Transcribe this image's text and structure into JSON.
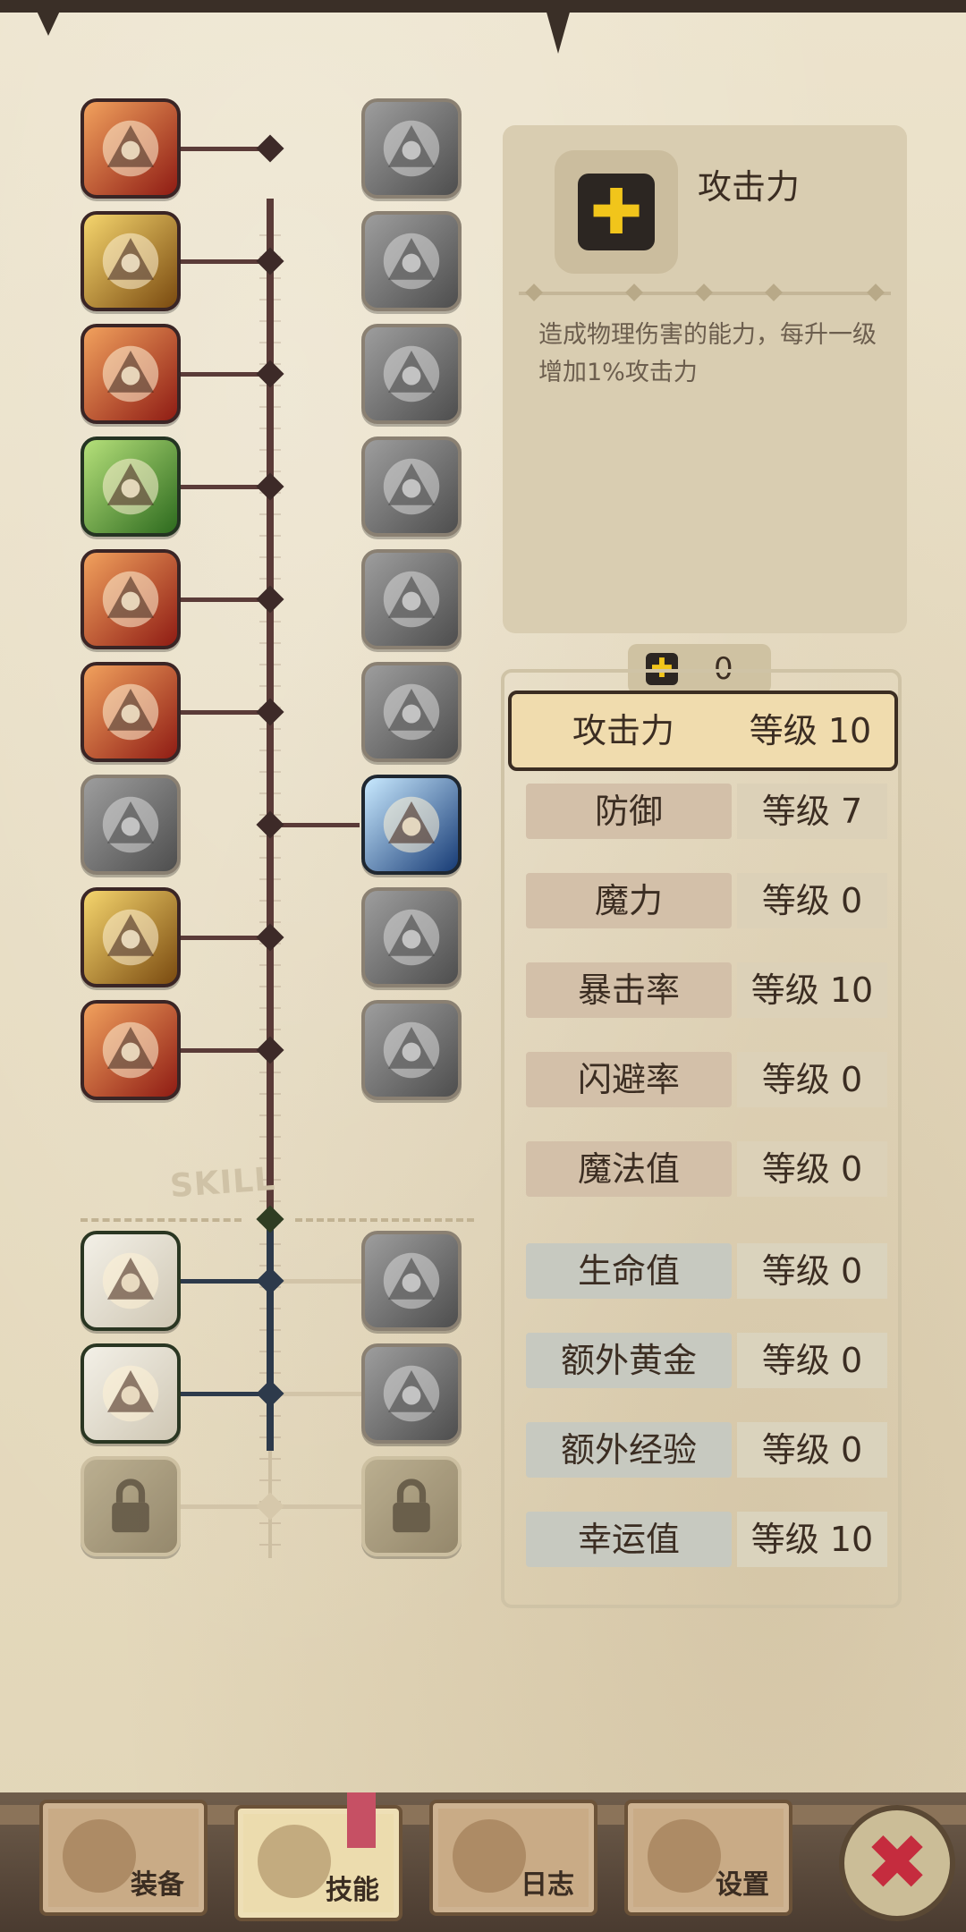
{
  "info": {
    "title": "攻击力",
    "plus_symbol": "✚",
    "description": "造成物理伤害的能力，每升一级增加1%攻击力"
  },
  "points": {
    "value": "0"
  },
  "skill_label": "SKILL",
  "stats": [
    {
      "name": "攻击力",
      "level": "等级 10",
      "group": "red",
      "selected": true
    },
    {
      "name": "防御",
      "level": "等级 7",
      "group": "red"
    },
    {
      "name": "魔力",
      "level": "等级 0",
      "group": "red"
    },
    {
      "name": "暴击率",
      "level": "等级 10",
      "group": "red"
    },
    {
      "name": "闪避率",
      "level": "等级 0",
      "group": "red"
    },
    {
      "name": "魔法值",
      "level": "等级 0",
      "group": "red"
    },
    {
      "name": "生命值",
      "level": "等级 0",
      "group": "blue"
    },
    {
      "name": "额外黄金",
      "level": "等级 0",
      "group": "blue"
    },
    {
      "name": "额外经验",
      "level": "等级 0",
      "group": "blue"
    },
    {
      "name": "幸运值",
      "level": "等级 10",
      "group": "blue"
    }
  ],
  "tabs": [
    {
      "label": "装备",
      "icon": "axe-icon",
      "active": false
    },
    {
      "label": "技能",
      "icon": "skill-icon",
      "active": true
    },
    {
      "label": "日志",
      "icon": "book-icon",
      "active": false
    },
    {
      "label": "设置",
      "icon": "gear-icon",
      "active": false
    }
  ],
  "close_symbol": "✖",
  "skills_left": [
    {
      "name": "cleaver-skill-icon",
      "style": "active-red"
    },
    {
      "name": "dash-strike-skill-icon",
      "style": "active-gold"
    },
    {
      "name": "roar-skill-icon",
      "style": "active-red"
    },
    {
      "name": "muscle-skill-icon",
      "style": "active-green"
    },
    {
      "name": "blade-spin-skill-icon",
      "style": "active-red"
    },
    {
      "name": "dagger-skill-icon",
      "style": "active-red"
    },
    {
      "name": "shadow-skill-icon",
      "style": "gray"
    },
    {
      "name": "lightning-burst-skill-icon",
      "style": "active-gold"
    },
    {
      "name": "crossed-swords-skill-icon",
      "style": "active-red"
    }
  ],
  "skills_right": [
    {
      "name": "shield-skill-icon",
      "style": "gray"
    },
    {
      "name": "punch-skill-icon",
      "style": "gray"
    },
    {
      "name": "thunder-skill-icon",
      "style": "gray"
    },
    {
      "name": "charge-skill-icon",
      "style": "gray"
    },
    {
      "name": "explosion-skill-icon",
      "style": "gray"
    },
    {
      "name": "eye-vortex-skill-icon",
      "style": "gray"
    },
    {
      "name": "sword-slash-skill-icon",
      "style": "blue"
    },
    {
      "name": "smoke-skill-icon",
      "style": "gray"
    },
    {
      "name": "sparkle-skill-icon",
      "style": "gray"
    }
  ],
  "tools_left": [
    {
      "name": "magnet-chest-tool-icon",
      "style": "green-tool"
    },
    {
      "name": "hand-chest-tool-icon",
      "style": "green-tool"
    },
    {
      "name": "locked-slot-icon",
      "style": "locked"
    }
  ],
  "tools_right": [
    {
      "name": "eye-chest-tool-icon",
      "style": "gray"
    },
    {
      "name": "eye-box-tool-icon",
      "style": "gray"
    },
    {
      "name": "locked-slot-icon",
      "style": "locked"
    }
  ]
}
